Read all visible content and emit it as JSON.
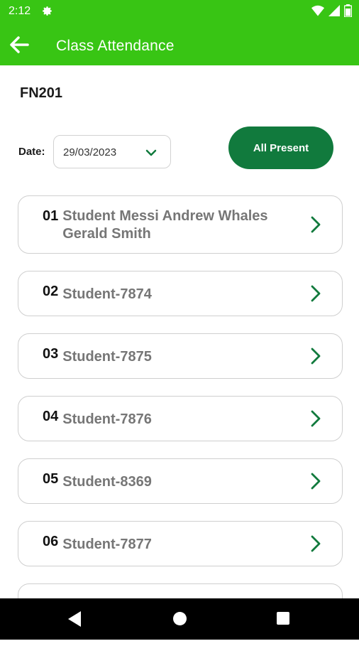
{
  "status_bar": {
    "time": "2:12",
    "icons": [
      "gear-icon",
      "wifi-icon",
      "signal-icon",
      "battery-icon"
    ]
  },
  "app_bar": {
    "title": "Class Attendance",
    "back_icon": "arrow-left-icon"
  },
  "class_code": "FN201",
  "date_picker": {
    "label": "Date:",
    "value": "29/03/2023",
    "icon": "chevron-down-icon"
  },
  "all_present_label": "All Present",
  "students": [
    {
      "number": "01",
      "name": "Student Messi Andrew Whales Gerald Smith"
    },
    {
      "number": "02",
      "name": "Student-7874"
    },
    {
      "number": "03",
      "name": "Student-7875"
    },
    {
      "number": "04",
      "name": "Student-7876"
    },
    {
      "number": "05",
      "name": "Student-8369"
    },
    {
      "number": "06",
      "name": "Student-7877"
    }
  ],
  "nav_bar": {
    "icons": [
      "back-triangle-icon",
      "home-circle-icon",
      "recents-square-icon"
    ]
  },
  "colors": {
    "primary": "#38c514",
    "button": "#117a3d",
    "chevron": "#117a3d"
  }
}
